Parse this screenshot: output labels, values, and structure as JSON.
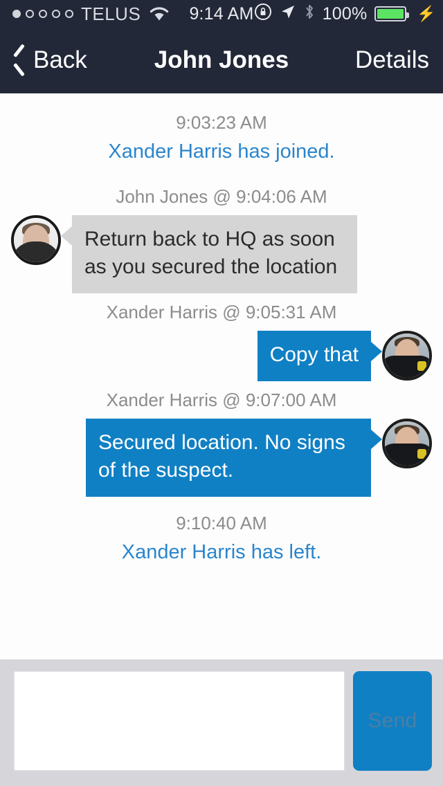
{
  "status_bar": {
    "carrier": "TELUS",
    "time": "9:14 AM",
    "battery_percent": "100%",
    "signal_dots_total": 5,
    "signal_dots_filled": 1,
    "icons": [
      "wifi-icon",
      "rotation-lock-icon",
      "location-arrow-icon",
      "bluetooth-icon",
      "battery-icon",
      "charging-bolt-icon"
    ],
    "battery_color": "#5ce364",
    "bar_color": "#232838"
  },
  "nav": {
    "back_label": "Back",
    "title": "John Jones",
    "details_label": "Details",
    "bar_color": "#232838"
  },
  "conversation": {
    "accent_blue": "#1080c4",
    "incoming_bubble_color": "#d5d5d5",
    "system_text_color": "#2a85cc",
    "meta_text_color": "#8c8c8c",
    "events": [
      {
        "kind": "system",
        "time": "9:03:23 AM",
        "text": "Xander Harris has joined."
      },
      {
        "kind": "message",
        "direction": "incoming",
        "meta": "John Jones @ 9:04:06 AM",
        "sender": "John Jones",
        "time": "9:04:06 AM",
        "text": "Return back to HQ as soon as you secured the location",
        "avatar": "civilian-avatar"
      },
      {
        "kind": "message",
        "direction": "outgoing",
        "meta": "Xander Harris @ 9:05:31 AM",
        "sender": "Xander Harris",
        "time": "9:05:31 AM",
        "text": "Copy that",
        "avatar": "officer-avatar"
      },
      {
        "kind": "message",
        "direction": "outgoing",
        "meta": "Xander Harris @ 9:07:00 AM",
        "sender": "Xander Harris",
        "time": "9:07:00 AM",
        "text": "Secured location. No signs of the suspect.",
        "avatar": "officer-avatar"
      },
      {
        "kind": "system",
        "time": "9:10:40 AM",
        "text": "Xander Harris has left."
      }
    ]
  },
  "composer": {
    "input_value": "",
    "input_placeholder": "",
    "send_label": "Send",
    "send_button_color": "#1080c4",
    "toolbar_color": "#d6d6da"
  }
}
